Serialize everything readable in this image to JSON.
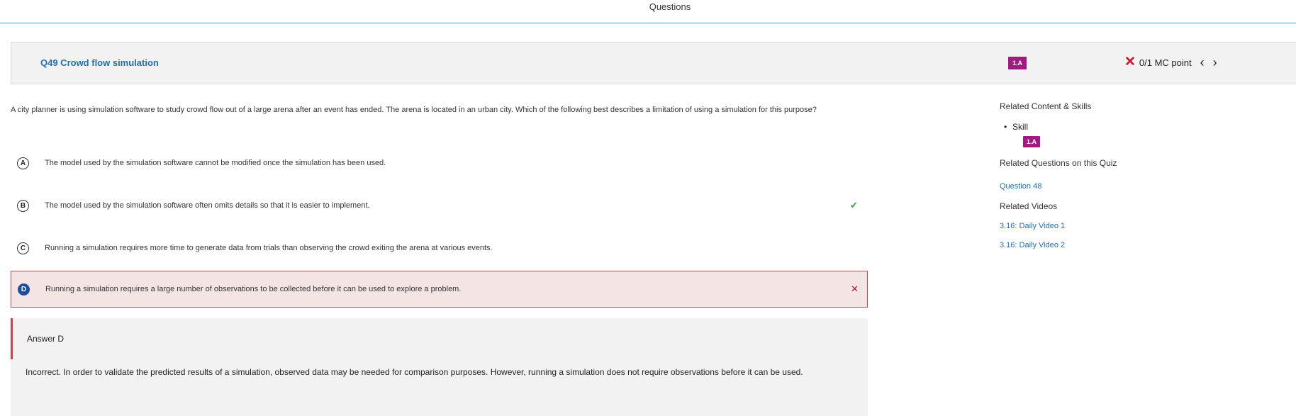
{
  "header": {
    "title": "Questions"
  },
  "question": {
    "title": "Q49 Crowd flow simulation",
    "skill_badge": "1.A",
    "score": "0/1 MC point",
    "prompt": "A city planner is using simulation software to study crowd flow out of a large arena after an event has ended. The arena is located in an urban city. Which of the following best describes a limitation of using a simulation for this purpose?"
  },
  "options": [
    {
      "letter": "A",
      "text": "The model used by the simulation software cannot be modified once the simulation has been used."
    },
    {
      "letter": "B",
      "text": "The model used by the simulation software often omits details so that it is easier to implement.",
      "mark": "✔"
    },
    {
      "letter": "C",
      "text": "Running a simulation requires more time to generate data from trials than observing the crowd exiting the arena at various events."
    },
    {
      "letter": "D",
      "text": "Running a simulation requires a large number of observations to be collected before it can be used to explore a problem.",
      "mark": "✕"
    }
  ],
  "answer": {
    "title": "Answer D",
    "explanation": "Incorrect. In order to validate the predicted results of a simulation, observed data may be needed for comparison purposes. However, running a simulation does not require observations before it can be used."
  },
  "sidebar": {
    "related_content_heading": "Related Content & Skills",
    "skill_label": "Skill",
    "skill_badge": "1.A",
    "related_questions_heading": "Related Questions on this Quiz",
    "related_question_link": "Question 48",
    "related_videos_heading": "Related Videos",
    "videos": [
      "3.16: Daily Video 1",
      "3.16: Daily Video 2"
    ]
  },
  "colors": {
    "accent": "#1f6fb5",
    "badge": "#a21a7f",
    "error": "#c8102e",
    "correct": "#3a9c3a"
  },
  "icons": {
    "wrong": "x-icon",
    "prev": "chevron-left-icon",
    "next": "chevron-right-icon"
  }
}
